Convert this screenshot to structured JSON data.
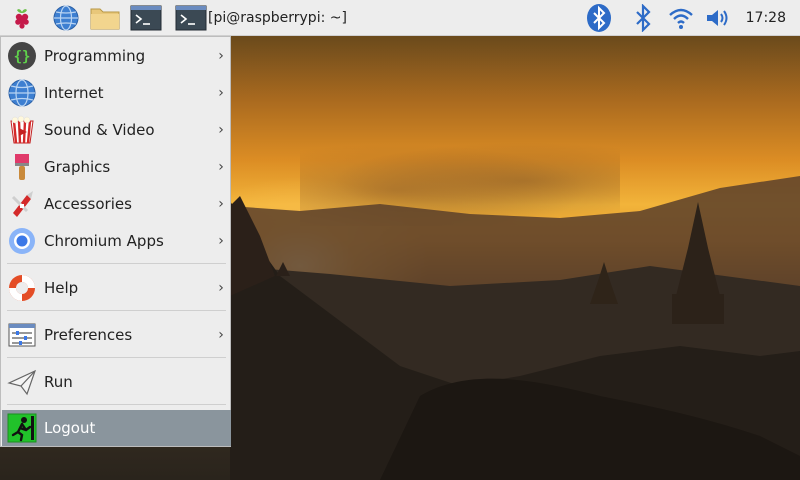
{
  "taskbar": {
    "menu_button_icon": "raspberry-icon",
    "launchers": [
      {
        "icon": "web-browser-globe-icon"
      },
      {
        "icon": "file-manager-folder-icon"
      },
      {
        "icon": "terminal-icon"
      }
    ],
    "window_task": {
      "icon": "terminal-icon",
      "title": "[pi@raspberrypi: ~]"
    },
    "tray": [
      "bluetooth-icon",
      "bluetooth-icon",
      "wifi-icon",
      "volume-icon"
    ],
    "clock": "17:28"
  },
  "menu": {
    "items": [
      {
        "label": "Programming",
        "icon": "programming-icon",
        "submenu": true
      },
      {
        "label": "Internet",
        "icon": "internet-globe-icon",
        "submenu": true
      },
      {
        "label": "Sound & Video",
        "icon": "sound-video-icon",
        "submenu": true
      },
      {
        "label": "Graphics",
        "icon": "graphics-brush-icon",
        "submenu": true
      },
      {
        "label": "Accessories",
        "icon": "accessories-knife-icon",
        "submenu": true
      },
      {
        "label": "Chromium Apps",
        "icon": "chromium-icon",
        "submenu": true
      },
      {
        "label": "Help",
        "icon": "help-lifebuoy-icon",
        "submenu": true
      },
      {
        "label": "Preferences",
        "icon": "preferences-icon",
        "submenu": true
      },
      {
        "label": "Run",
        "icon": "run-paper-plane-icon",
        "submenu": false
      },
      {
        "label": "Logout",
        "icon": "logout-running-man-icon",
        "submenu": false,
        "highlighted": true
      }
    ],
    "submenu_arrow": "›"
  },
  "colors": {
    "taskbar_bg": "#ededed",
    "menu_bg": "#ededed",
    "highlight": "#8a959d",
    "logout_icon_green": "#21c22a"
  }
}
